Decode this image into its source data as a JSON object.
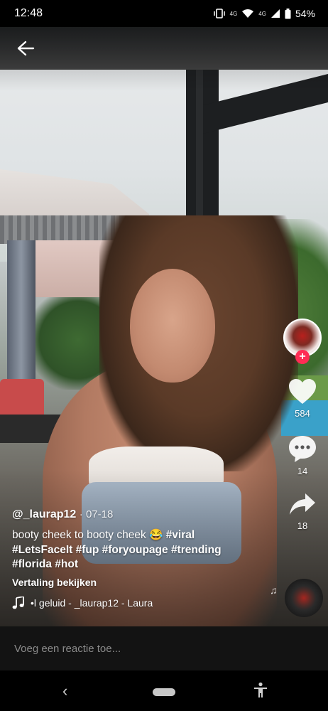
{
  "status_bar": {
    "time": "12:48",
    "network_small": "4G",
    "network": "4G",
    "battery": "54%"
  },
  "post": {
    "author": "@_laurap12",
    "date": "07-18",
    "caption_text": "booty cheek to booty cheek 😂",
    "hashtags_line1": "#viral",
    "hashtags_line2": "#LetsFaceIt #fup #foryoupage #trending",
    "hashtags_line3": "#florida #hot",
    "translate_label": "Vertaling bekijken",
    "sound": "•l geluid - _laurap12 - Laura"
  },
  "actions": {
    "likes": "584",
    "comments": "14",
    "shares": "18"
  },
  "comment_bar": {
    "placeholder": "Voeg een reactie toe..."
  },
  "icons": [
    "back-arrow-icon",
    "heart-icon",
    "comment-icon",
    "share-icon",
    "music-note-icon",
    "plus-icon",
    "accessibility-icon"
  ]
}
